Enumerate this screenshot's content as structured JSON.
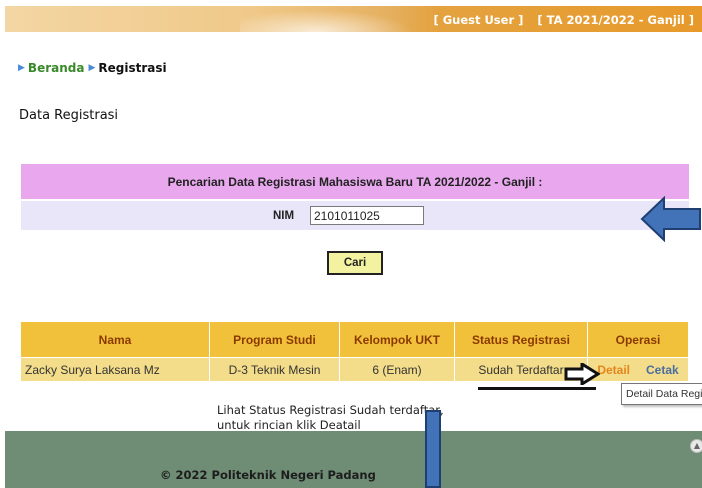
{
  "header": {
    "user_label": "[ Guest User ]",
    "term_label": "[ TA 2021/2022 - Ganjil ]"
  },
  "breadcrumb": {
    "home": "Beranda",
    "current": "Registrasi"
  },
  "page": {
    "title": "Data Registrasi"
  },
  "search": {
    "title": "Pencarian Data Registrasi Mahasiswa Baru TA 2021/2022 - Ganjil :",
    "nim_label": "NIM",
    "nim_value": "2101011025",
    "button_label": "Cari"
  },
  "results": {
    "headers": [
      "Nama",
      "Program Studi",
      "Kelompok UKT",
      "Status Registrasi",
      "Operasi"
    ],
    "rows": [
      {
        "nama": "Zacky Surya Laksana Mz",
        "program_studi": "D-3 Teknik Mesin",
        "kelompok_ukt": "6 (Enam)",
        "status": "Sudah Terdaftar",
        "detail_link": "Detail",
        "cetak_link": "Cetak"
      }
    ],
    "tooltip": "Detail Data Registrasi"
  },
  "info": {
    "line1": "Lihat Status Registrasi Sudah terdaftar,",
    "line2": "untuk rincian klik Deatail"
  },
  "footer": {
    "copyright": "© 2022 Politeknik Negeri Padang"
  },
  "colors": {
    "search_header_bg": "#e9a8ee",
    "search_row_bg": "#e8e6f8",
    "table_header_bg": "#f2c13c",
    "table_row_bg": "#f4dd8a",
    "footer_bg": "#6f8c74",
    "annotation_blue": "#4273b8"
  }
}
